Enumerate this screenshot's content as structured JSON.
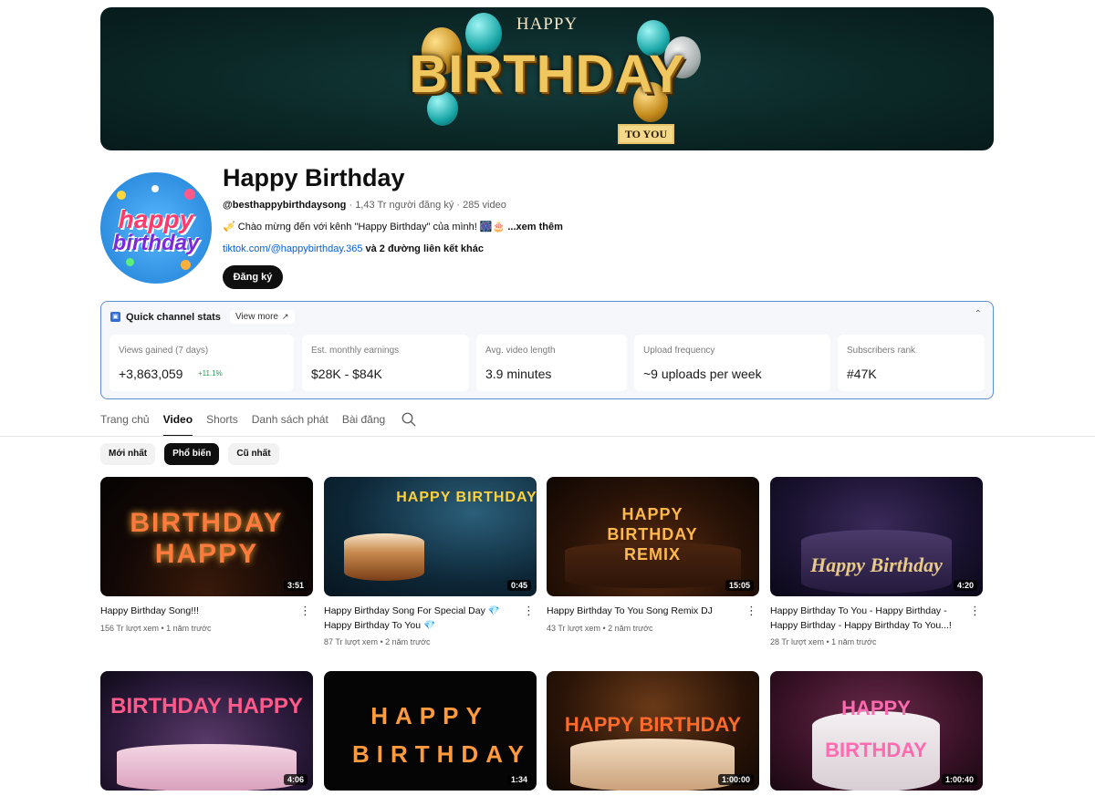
{
  "banner": {
    "line1": "HAPPY",
    "line2": "BIRTHDAY",
    "line3": "TO YOU"
  },
  "avatar": {
    "line1": "happy",
    "line2": "birthday"
  },
  "channel": {
    "title": "Happy Birthday",
    "handle": "@besthappybirthdaysong",
    "subscribers": "1,43 Tr người đăng ký",
    "videos": "285 video",
    "description": "🎺 Chào mừng đến với kênh \"Happy Birthday\" của mình! 🎆🎂",
    "more": " ...xem thêm",
    "link": "tiktok.com/@happybirthday.365",
    "link_rest": " và 2 đường liên kết khác",
    "subscribe": "Đăng ký"
  },
  "stats": {
    "title": "Quick channel stats",
    "view_more": "View more",
    "cards": [
      {
        "label": "Views gained (7 days)",
        "value": "+3,863,059",
        "change": "+11.1%"
      },
      {
        "label": "Est. monthly earnings",
        "value": "$28K - $84K"
      },
      {
        "label": "Avg. video length",
        "value": "3.9 minutes"
      },
      {
        "label": "Upload frequency",
        "value": "~9 uploads per week"
      },
      {
        "label": "Subscribers rank",
        "value": "#47K"
      }
    ]
  },
  "tabs": [
    "Trang chủ",
    "Video",
    "Shorts",
    "Danh sách phát",
    "Bài đăng"
  ],
  "active_tab": "Video",
  "chips": [
    "Mới nhất",
    "Phổ biến",
    "Cũ nhất"
  ],
  "active_chip": "Phổ biến",
  "videos": [
    {
      "title": "Happy Birthday Song!!!",
      "views": "156 Tr lượt xem",
      "age": "1 năm trước",
      "duration": "3:51",
      "thumb_text": "BIRTHDAY HAPPY"
    },
    {
      "title": "Happy Birthday Song For Special Day 💎 Happy Birthday To You 💎",
      "views": "87 Tr lượt xem",
      "age": "2 năm trước",
      "duration": "0:45",
      "thumb_text": "HAPPY BIRTHDAY"
    },
    {
      "title": "Happy Birthday To You Song Remix DJ",
      "views": "43 Tr lượt xem",
      "age": "2 năm trước",
      "duration": "15:05",
      "thumb_text": "HAPPY BIRTHDAY REMIX"
    },
    {
      "title": "Happy Birthday To You - Happy Birthday - Happy Birthday - Happy Birthday To You...!",
      "views": "28 Tr lượt xem",
      "age": "1 năm trước",
      "duration": "4:20",
      "thumb_text": "Happy Birthday"
    },
    {
      "title": "",
      "views": "",
      "age": "",
      "duration": "4:06",
      "thumb_text": "BIRTHDAY HAPPY"
    },
    {
      "title": "",
      "views": "",
      "age": "",
      "duration": "1:34",
      "thumb_text": "HAPPY BIRTHDAY"
    },
    {
      "title": "",
      "views": "",
      "age": "",
      "duration": "1:00:00",
      "thumb_text": "HAPPY BIRTHDAY"
    },
    {
      "title": "",
      "views": "",
      "age": "",
      "duration": "1:00:40",
      "thumb_text": "HAPPY BIRTHDAY"
    }
  ],
  "colors": {
    "accent": "#0f0f0f",
    "link": "#065fd4",
    "stats_border": "#5b8fd6",
    "positive": "#1f9d55"
  }
}
